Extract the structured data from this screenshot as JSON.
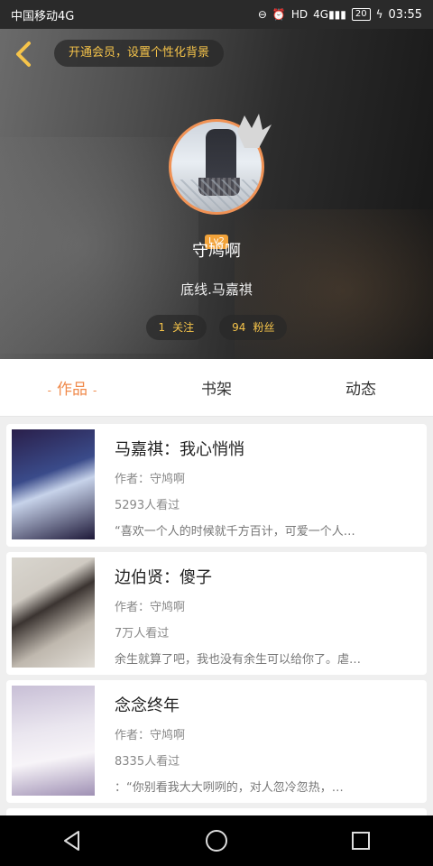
{
  "status": {
    "carrier": "中国移动4G",
    "network": "4G",
    "hd": "HD",
    "battery": "20",
    "time": "03:55"
  },
  "header": {
    "vip_text": "开通会员，设置个性化背景",
    "level": "Lv2",
    "username": "守鸠啊",
    "bio": "底线.马嘉祺",
    "following_count": "1",
    "following_label": "关注",
    "followers_count": "94",
    "followers_label": "粉丝"
  },
  "tabs": [
    {
      "label": "作品",
      "active": true
    },
    {
      "label": "书架",
      "active": false
    },
    {
      "label": "动态",
      "active": false
    }
  ],
  "works": [
    {
      "title": "马嘉祺：我心悄悄",
      "author": "作者：守鸠啊",
      "views": "5293人看过",
      "excerpt": "“喜欢一个人的时候就千方百计，可爱一个人…"
    },
    {
      "title": "边伯贤：傻子",
      "author": "作者：守鸠啊",
      "views": "7万人看过",
      "excerpt": "余生就算了吧，我也没有余生可以给你了。虐…"
    },
    {
      "title": "念念终年",
      "author": "作者：守鸠啊",
      "views": "8335人看过",
      "excerpt": "：“你别看我大大咧咧的，对人忽冷忽热，…"
    }
  ],
  "colors": {
    "accent": "#f08a4b",
    "gold": "#f6c44a"
  }
}
